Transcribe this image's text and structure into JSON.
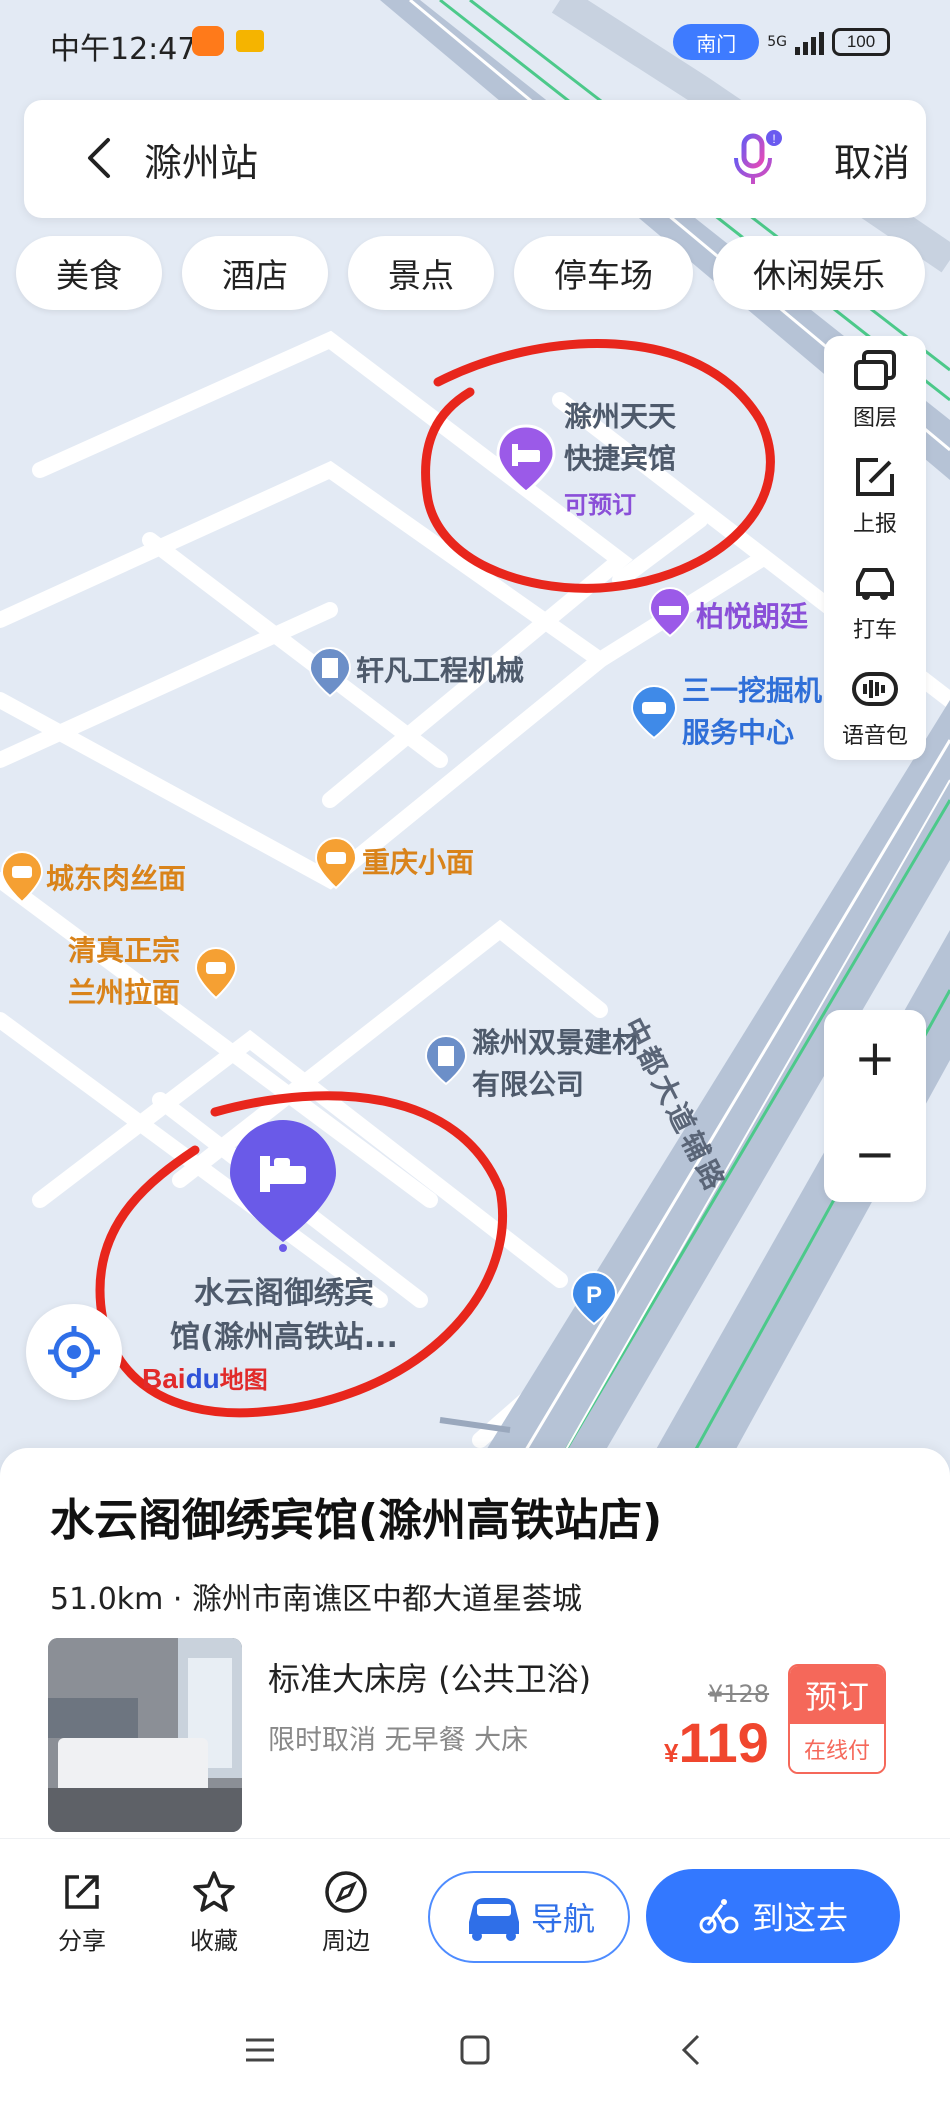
{
  "status_bar": {
    "time": "中午12:47",
    "nav_pill": "南门",
    "network": "5G",
    "battery": "100"
  },
  "search": {
    "query": "滁州站",
    "cancel_label": "取消"
  },
  "categories": [
    "美食",
    "酒店",
    "景点",
    "停车场",
    "休闲娱乐"
  ],
  "side_tools": {
    "layers": "图层",
    "report": "上报",
    "taxi": "打车",
    "voice": "语音包"
  },
  "map": {
    "pois": {
      "hotel_tiantian_line1": "滁州天天",
      "hotel_tiantian_line2": "快捷宾馆",
      "hotel_tiantian_tag": "可预订",
      "boyue": "柏悦朗廷",
      "xuanfan": "轩凡工程机械",
      "sany_line1": "三一挖掘机",
      "sany_line2": "服务中心",
      "chengdong": "城东肉丝面",
      "chongqing": "重庆小面",
      "lanzhou_line1": "清真正宗",
      "lanzhou_line2": "兰州拉面",
      "shuangjing_line1": "滁州双景建材",
      "shuangjing_line2": "有限公司",
      "selected_line1": "水云阁御绣宾",
      "selected_line2": "馆(滁州高铁站..."
    },
    "road_name": "中都大道辅路",
    "logo_text_bai": "Bai",
    "logo_text_du": "du",
    "logo_text_map": "地图"
  },
  "place_card": {
    "title": "水云阁御绣宾馆(滁州高铁站店)",
    "distance_address": "51.0km · 滁州市南谯区中都大道星荟城",
    "room": {
      "name": "标准大床房 (公共卫浴)",
      "tags": "限时取消 无早餐 大床",
      "original_price": "¥128",
      "currency": "¥",
      "price": "119",
      "book_label": "预订",
      "book_sub": "在线付"
    }
  },
  "actions": {
    "share": "分享",
    "favorite": "收藏",
    "nearby": "周边",
    "navigate": "导航",
    "go_here": "到这去"
  },
  "colors": {
    "accent_blue": "#3378ff",
    "annotation_red": "#e8261c",
    "hotel_purple": "#8a5ae8",
    "price_red": "#f0462e"
  }
}
